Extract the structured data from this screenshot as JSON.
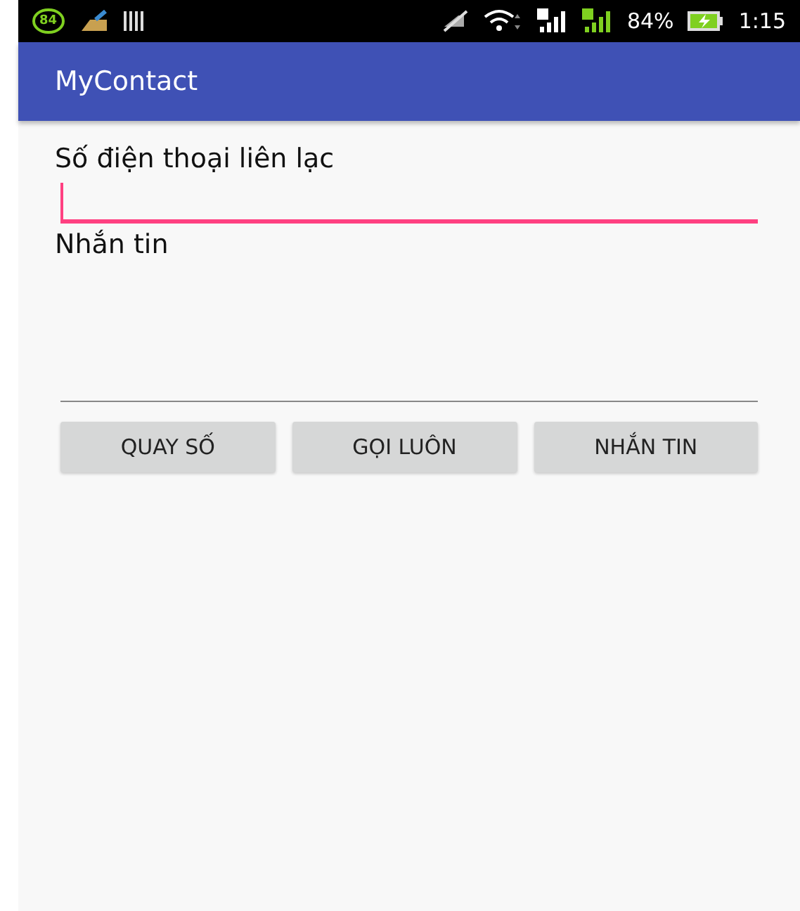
{
  "status_bar": {
    "notification_badge": "84",
    "battery_percent": "84%",
    "time": "1:15"
  },
  "app_bar": {
    "title": "MyContact"
  },
  "fields": [
    {
      "label": "Số điện thoại liên lạc",
      "focused": true,
      "multiline": false
    },
    {
      "label": "Nhắn tin",
      "focused": false,
      "multiline": true
    }
  ],
  "buttons": [
    "QUAY SỐ",
    "GỌI LUÔN",
    "NHẮN TIN"
  ]
}
